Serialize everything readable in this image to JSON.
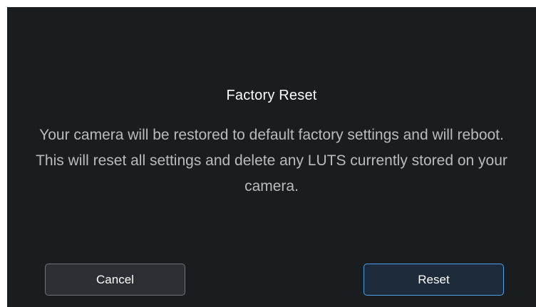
{
  "dialog": {
    "title": "Factory Reset",
    "message": "Your camera will be restored to default factory settings and will reboot. This will reset all settings and delete any LUTS currently stored on your camera."
  },
  "buttons": {
    "cancel_label": "Cancel",
    "reset_label": "Reset"
  },
  "colors": {
    "background": "#1a1d20",
    "accent": "#4aa3e8"
  }
}
